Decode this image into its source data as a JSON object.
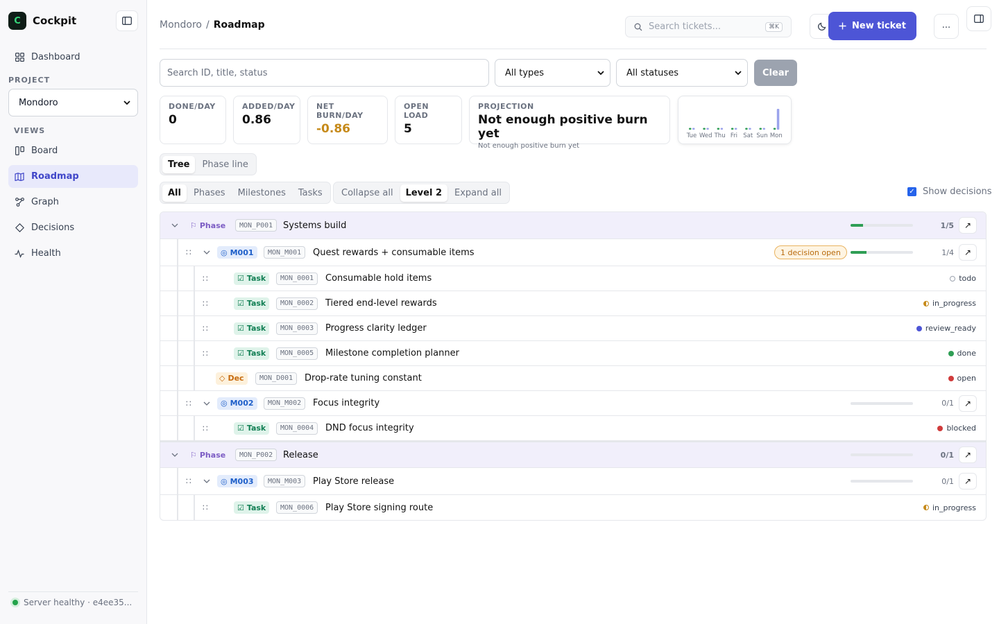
{
  "app": {
    "name": "Cockpit",
    "logo_letter": "C"
  },
  "sidebar": {
    "top_item": {
      "label": "Dashboard"
    },
    "project_label": "PROJECT",
    "project_value": "Mondoro",
    "views_label": "VIEWS",
    "views": [
      {
        "label": "Board",
        "icon": "board-icon",
        "active": false
      },
      {
        "label": "Roadmap",
        "icon": "roadmap-icon",
        "active": true
      },
      {
        "label": "Graph",
        "icon": "graph-icon",
        "active": false
      },
      {
        "label": "Decisions",
        "icon": "decisions-icon",
        "active": false
      },
      {
        "label": "Health",
        "icon": "health-icon",
        "active": false
      }
    ],
    "server_status": "Server healthy · e4ee35..."
  },
  "header": {
    "breadcrumb_project": "Mondoro",
    "breadcrumb_sep": "/",
    "breadcrumb_page": "Roadmap",
    "search_placeholder": "Search tickets...",
    "search_shortcut": "⌘K",
    "new_ticket_label": "New ticket",
    "more_label": "..."
  },
  "filters": {
    "search_placeholder": "Search ID, title, status",
    "type_value": "All types",
    "status_value": "All statuses",
    "clear_label": "Clear"
  },
  "stats": [
    {
      "label": "DONE/DAY",
      "value": "0"
    },
    {
      "label": "ADDED/DAY",
      "value": "0.86"
    },
    {
      "label": "NET BURN/DAY",
      "value": "-0.86"
    },
    {
      "label": "OPEN LOAD",
      "value": "5"
    },
    {
      "label": "PROJECTION",
      "value": "Not enough positive burn yet",
      "sub": "Not enough positive burn yet"
    }
  ],
  "chart_data": {
    "type": "bar",
    "categories": [
      "Tue",
      "Wed",
      "Thu",
      "Fri",
      "Sat",
      "Sun",
      "Mon"
    ],
    "series": [
      {
        "values": [
          0,
          0,
          0,
          0,
          0,
          0,
          0
        ],
        "color": "#2f9e55"
      },
      {
        "values": [
          0,
          0,
          0,
          0,
          0,
          0,
          6
        ],
        "color": "#9ba3ec"
      }
    ]
  },
  "views_toggle": {
    "items": [
      "Tree",
      "Phase line"
    ],
    "active": "Tree"
  },
  "kind_filter": {
    "items": [
      "All",
      "Phases",
      "Milestones",
      "Tasks"
    ],
    "active": "All"
  },
  "level_toggle": {
    "items": [
      "Collapse all",
      "Level 2",
      "Expand all"
    ],
    "active": "Level 2"
  },
  "show_decisions": {
    "label": "Show decisions",
    "checked": true
  },
  "tree": {
    "phase1": {
      "type": "Phase",
      "id": "MON_P001",
      "title": "Systems build",
      "count": "1/5",
      "progress": 0.2
    },
    "m001": {
      "type": "M001",
      "id": "MON_M001",
      "title": "Quest rewards + consumable items",
      "decision_pill": "1 decision open",
      "count": "1/4",
      "progress": 0.25
    },
    "t1": {
      "type": "Task",
      "id": "MON_0001",
      "title": "Consumable hold items",
      "status": "todo"
    },
    "t2": {
      "type": "Task",
      "id": "MON_0002",
      "title": "Tiered end-level rewards",
      "status": "in_progress"
    },
    "t3": {
      "type": "Task",
      "id": "MON_0003",
      "title": "Progress clarity ledger",
      "status": "review_ready"
    },
    "t5": {
      "type": "Task",
      "id": "MON_0005",
      "title": "Milestone completion planner",
      "status": "done"
    },
    "d1": {
      "type": "Dec",
      "id": "MON_D001",
      "title": "Drop-rate tuning constant",
      "status": "open"
    },
    "m002": {
      "type": "M002",
      "id": "MON_M002",
      "title": "Focus integrity",
      "count": "0/1",
      "progress": 0
    },
    "t4": {
      "type": "Task",
      "id": "MON_0004",
      "title": "DND focus integrity",
      "status": "blocked"
    },
    "phase2": {
      "type": "Phase",
      "id": "MON_P002",
      "title": "Release",
      "count": "0/1",
      "progress": 0
    },
    "m003": {
      "type": "M003",
      "id": "MON_M003",
      "title": "Play Store release",
      "count": "0/1",
      "progress": 0
    },
    "t6": {
      "type": "Task",
      "id": "MON_0006",
      "title": "Play Store signing route",
      "status": "in_progress"
    }
  },
  "colors": {
    "accent": "#4d55d6",
    "todo": "#9ca3af",
    "in_progress": "#c68a1a",
    "review_ready": "#4d55d6",
    "done": "#2f9e55",
    "open": "#d03b3b",
    "blocked": "#d03b3b"
  }
}
